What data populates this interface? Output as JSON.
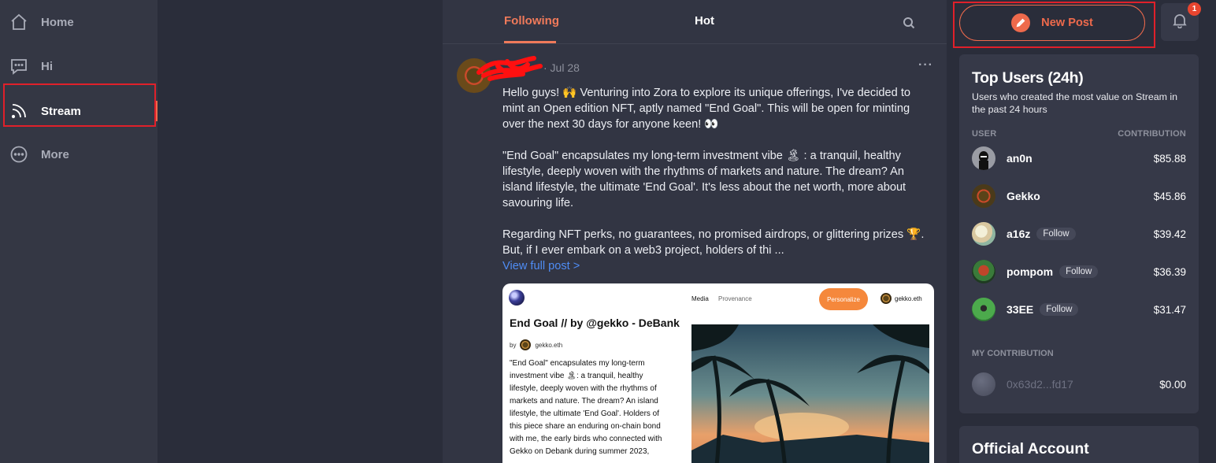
{
  "sidebar": {
    "items": [
      {
        "label": "Home",
        "icon": "home-icon"
      },
      {
        "label": "Hi",
        "icon": "chat-icon"
      },
      {
        "label": "Stream",
        "icon": "rss-icon",
        "active": true
      },
      {
        "label": "More",
        "icon": "more-circle-icon"
      }
    ]
  },
  "feed": {
    "tabs": [
      {
        "label": "Following",
        "active": true
      },
      {
        "label": "Hot"
      }
    ],
    "post": {
      "date": "· Jul 28",
      "paragraphs": [
        "Hello guys! 🙌 Venturing into Zora to explore its unique offerings, I've decided to mint an Open edition NFT, aptly named \"End Goal\". This will be open for minting over the next 30 days for anyone keen! 👀",
        "\"End Goal\" encapsulates my long-term investment vibe 🏝 : a tranquil, healthy lifestyle, deeply woven with the rhythms of markets and nature. The dream? An island lifestyle, the ultimate 'End Goal'. It's less about the net worth, more about savouring life.",
        "Regarding NFT perks, no guarantees, no promised airdrops, or glittering prizes 🏆. But, if I ever embark on a web3 project, holders of thi ..."
      ],
      "view_full": "View full post >",
      "embed": {
        "title": "End Goal // by @gekko - DeBank",
        "by": "by",
        "by_user": "gekko.eth",
        "description": "\"End Goal\" encapsulates my long-term investment vibe 🏝: a tranquil, healthy lifestyle, deeply woven with the rhythms of markets and nature. The dream? An island lifestyle, the ultimate 'End Goal'. Holders of this piece share an enduring on-chain bond with me, the early birds who connected with Gekko on Debank during summer 2023,",
        "nav_media": "Media",
        "nav_provenance": "Provenance",
        "button": "Personalize",
        "user": "gekko.eth"
      }
    }
  },
  "right": {
    "new_post": "New Post",
    "notification_count": "1",
    "top_users": {
      "title": "Top Users (24h)",
      "subtitle": "Users who created the most value on Stream in the past 24 hours",
      "col_user": "USER",
      "col_contribution": "CONTRIBUTION",
      "rows": [
        {
          "name": "an0n",
          "amount": "$85.88",
          "follow": ""
        },
        {
          "name": "Gekko",
          "amount": "$45.86",
          "follow": ""
        },
        {
          "name": "a16z",
          "amount": "$39.42",
          "follow": "Follow"
        },
        {
          "name": "pompom",
          "amount": "$36.39",
          "follow": "Follow"
        },
        {
          "name": "33EE",
          "amount": "$31.47",
          "follow": "Follow"
        }
      ],
      "my_contribution_label": "MY CONTRIBUTION",
      "my_address": "0x63d2...fd17",
      "my_amount": "$0.00"
    },
    "official_account": "Official Account"
  },
  "colors": {
    "accent": "#ee6a4c",
    "link": "#4f8df5",
    "highlight_box": "#e0202a"
  }
}
